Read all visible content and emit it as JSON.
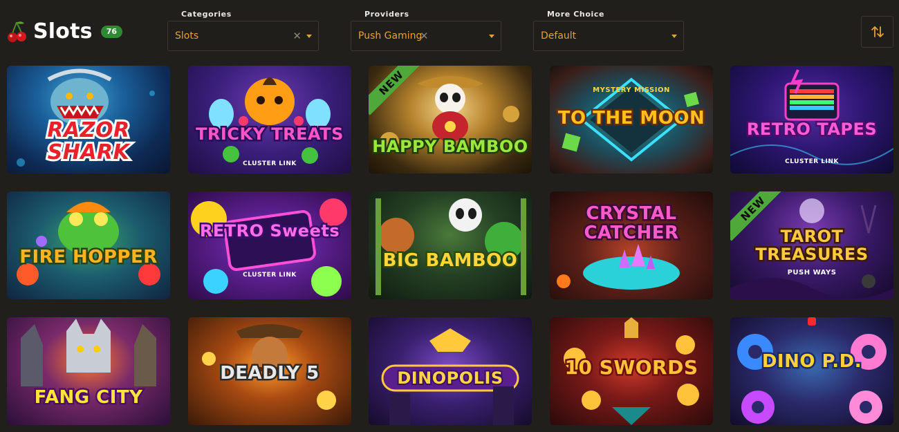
{
  "header": {
    "title": "Slots",
    "count": "76",
    "icon": "cherry-icon"
  },
  "filters": {
    "categories": {
      "label": "Categories",
      "value": "Slots"
    },
    "providers": {
      "label": "Providers",
      "value": "Push Gaming"
    },
    "more_choice": {
      "label": "More Choice",
      "value": "Default"
    }
  },
  "colors": {
    "background": "#211f1c",
    "accent": "#e8a136",
    "badge_green": "#2f8b33",
    "ribbon_green": "#4ea83a"
  },
  "games": [
    {
      "name": "RAZOR SHARK"
    },
    {
      "name": "TRICKY TREATS",
      "tag": "CLUSTER LINK"
    },
    {
      "name": "HAPPY BAMBOO",
      "badge": "NEW"
    },
    {
      "name": "TO THE MOON",
      "tag": "MYSTERY MISSION"
    },
    {
      "name": "RETRO TAPES",
      "tag": "CLUSTER LINK"
    },
    {
      "name": "FIRE HOPPER"
    },
    {
      "name": "RETRO Sweets",
      "tag": "CLUSTER LINK"
    },
    {
      "name": "BIG BAMBOO"
    },
    {
      "name": "CRYSTAL CATCHER"
    },
    {
      "name": "TAROT TREASURES",
      "tag": "PUSH WAYS",
      "badge": "NEW"
    },
    {
      "name": "FANG CITY"
    },
    {
      "name": "DEADLY 5"
    },
    {
      "name": "DINOPOLIS"
    },
    {
      "name": "10 SWORDS"
    },
    {
      "name": "DINO P.D."
    }
  ]
}
